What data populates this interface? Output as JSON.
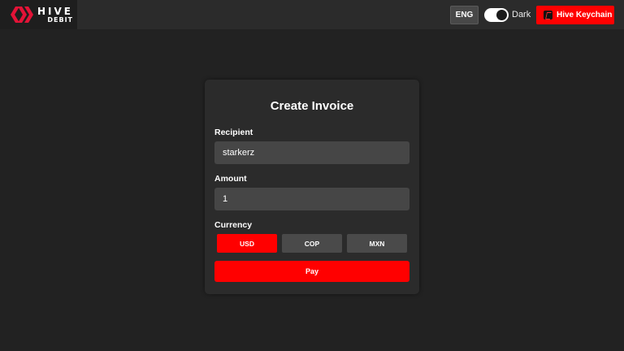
{
  "header": {
    "logo": {
      "word": "HIVE",
      "sub": "DEBIT"
    },
    "language": "ENG",
    "theme": {
      "label": "Dark",
      "dark_mode": true
    },
    "keychain_label": "Hive Keychain"
  },
  "invoice": {
    "title": "Create Invoice",
    "recipient": {
      "label": "Recipient",
      "value": "starkerz"
    },
    "amount": {
      "label": "Amount",
      "value": "1"
    },
    "currency": {
      "label": "Currency",
      "options": [
        "USD",
        "COP",
        "MXN"
      ],
      "selected": "USD"
    },
    "pay_label": "Pay"
  },
  "colors": {
    "accent": "#ff0000",
    "background": "#222222",
    "card": "#2b2b2b",
    "input": "#464646",
    "inactive_button": "#4a4a4a"
  }
}
